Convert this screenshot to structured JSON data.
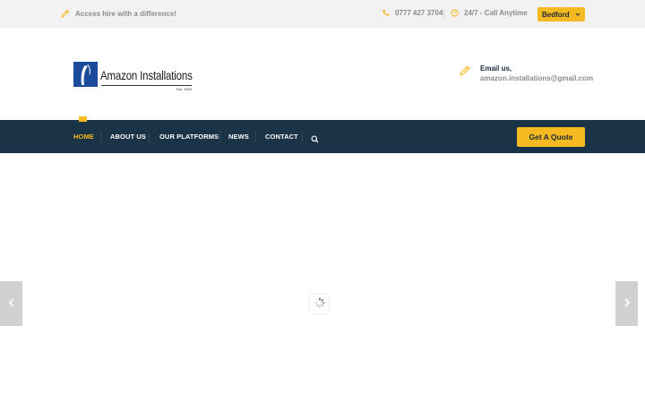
{
  "topbar": {
    "tagline": "Access hire with a difference!",
    "phone": "0777 427 3704",
    "hours": "24/7 - Call Anytime",
    "location": "Bedford"
  },
  "header": {
    "logo_name": "Amazon Installations",
    "logo_est": "Est. 1993",
    "email_label": "Email us,",
    "email_address": "amazon.installations@gmail.com"
  },
  "nav": {
    "items": [
      "HOME",
      "ABOUT US",
      "OUR PLATFORMS",
      "NEWS",
      "CONTACT"
    ],
    "active": "HOME",
    "quote_label": "Get A Quote"
  },
  "icons": {
    "tagline": "pencil-icon",
    "phone": "phone-icon",
    "hours": "clock-icon",
    "location": "chevron-down-icon",
    "email": "pencil-icon",
    "search": "search-icon",
    "prev": "chevron-left-icon",
    "next": "chevron-right-icon",
    "loading": "spinner-icon"
  },
  "colors": {
    "accent": "#f5b921",
    "nav_background": "#1b3347",
    "topbar_background": "#f2f2f2",
    "logo_blue": "#1d4b9c",
    "muted_text": "#8c8c8c"
  }
}
